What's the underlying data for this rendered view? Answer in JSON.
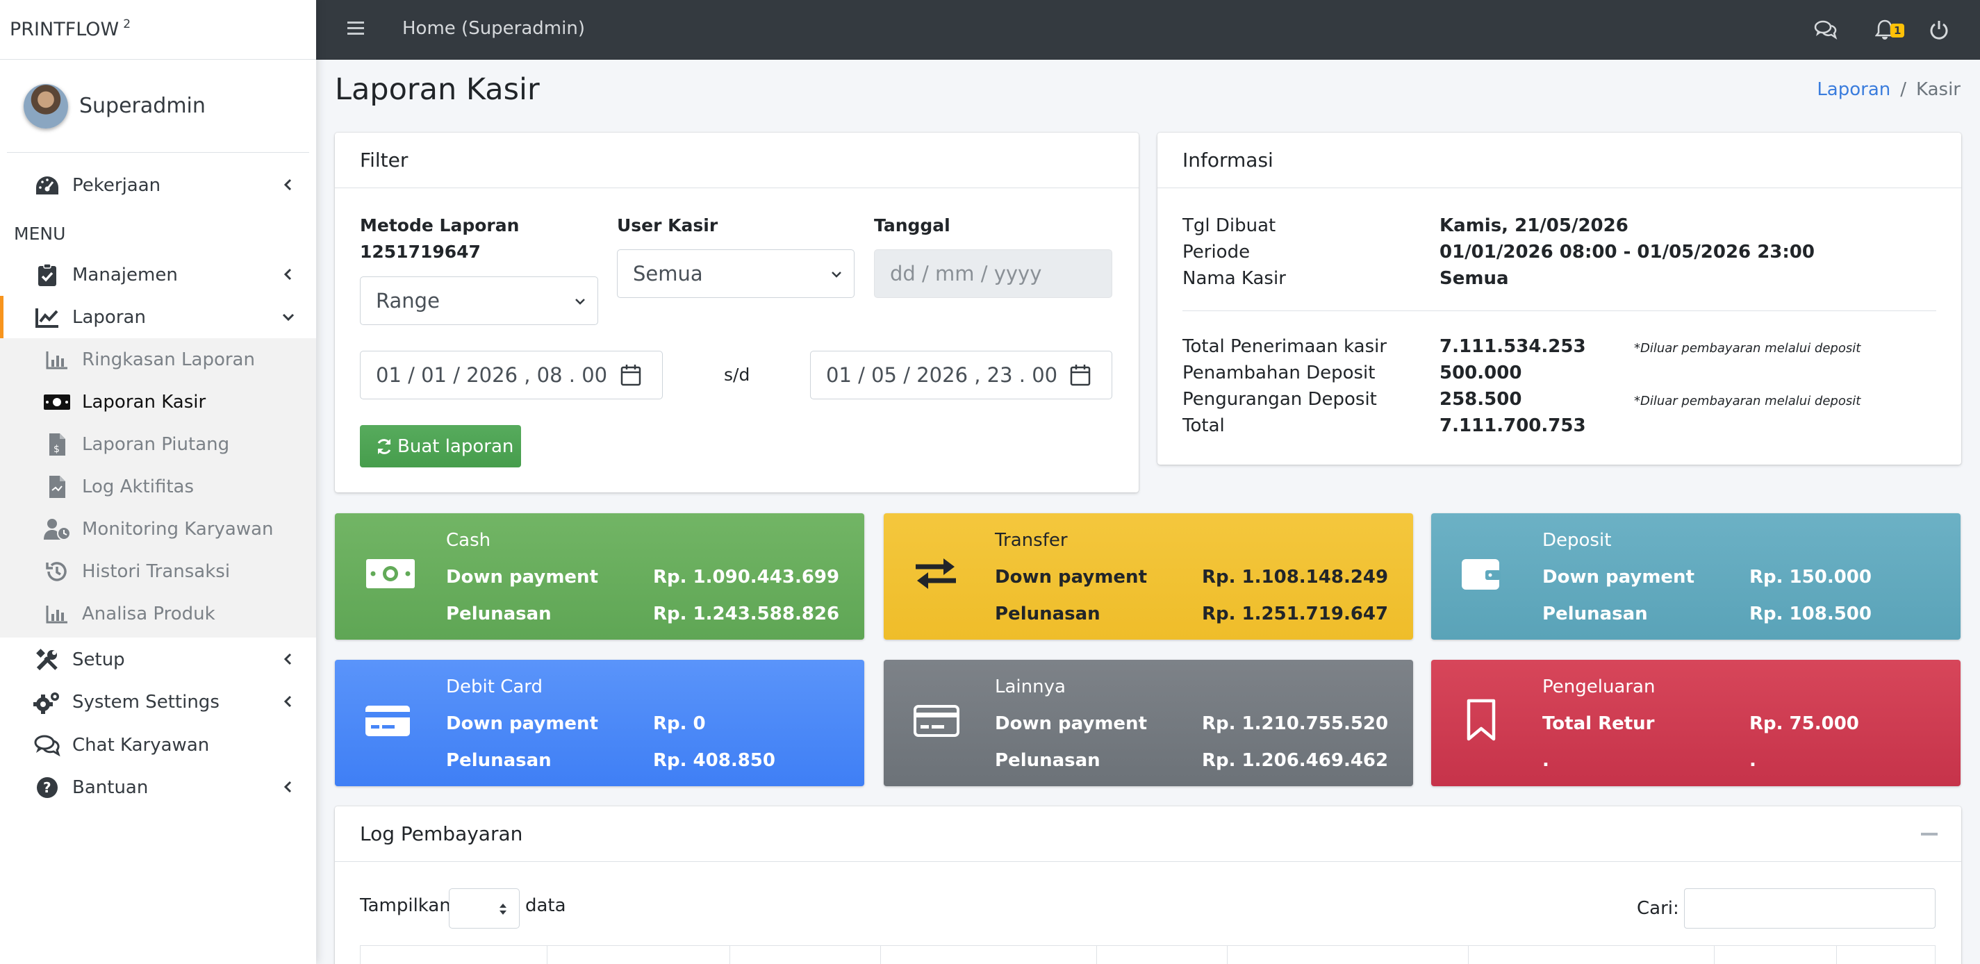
{
  "brand": {
    "name": "PRINTFLOW",
    "version": "2"
  },
  "user": {
    "name": "Superadmin"
  },
  "sidebar": {
    "menu_header": "MENU",
    "items": [
      {
        "label": "Pekerjaan",
        "icon": "tachometer-icon"
      },
      {
        "label": "Manajemen",
        "icon": "clipboard-check-icon"
      },
      {
        "label": "Laporan",
        "icon": "line-chart-icon"
      },
      {
        "label": "Setup",
        "icon": "tools-icon"
      },
      {
        "label": "System Settings",
        "icon": "cogs-icon"
      },
      {
        "label": "Chat Karyawan",
        "icon": "chat-icon"
      },
      {
        "label": "Bantuan",
        "icon": "question-circle-icon"
      }
    ],
    "sub_items": [
      {
        "label": "Ringkasan Laporan",
        "icon": "bar-chart-icon"
      },
      {
        "label": "Laporan Kasir",
        "icon": "money-bill-icon"
      },
      {
        "label": "Laporan Piutang",
        "icon": "invoice-dollar-icon"
      },
      {
        "label": "Log Aktifitas",
        "icon": "file-log-icon"
      },
      {
        "label": "Monitoring Karyawan",
        "icon": "user-clock-icon"
      },
      {
        "label": "Histori Transaksi",
        "icon": "history-icon"
      },
      {
        "label": "Analisa Produk",
        "icon": "bar-chart-icon"
      }
    ]
  },
  "topbar": {
    "title": "Home (Superadmin)",
    "notification_count": "1"
  },
  "page": {
    "title": "Laporan Kasir",
    "breadcrumb": {
      "parent": "Laporan",
      "separator": "/",
      "current": "Kasir"
    }
  },
  "filter": {
    "title": "Filter",
    "metode_label": "Metode Laporan",
    "metode_sub": "1251719647",
    "metode_value": "Range",
    "user_label": "User Kasir",
    "user_value": "Semua",
    "tanggal_label": "Tanggal",
    "tanggal_placeholder": "dd / mm / yyyy",
    "start_value": "01 / 01 / 2026 ,  08 . 00",
    "separator": "s/d",
    "end_value": "01 / 05 / 2026 ,  23 . 00",
    "button_label": "Buat laporan"
  },
  "info": {
    "title": "Informasi",
    "tgl_label": "Tgl Dibuat",
    "tgl_value": "Kamis, 21/05/2026",
    "periode_label": "Periode",
    "periode_value": "01/01/2026 08:00 - 01/05/2026 23:00",
    "kasir_label": "Nama Kasir",
    "kasir_value": "Semua",
    "penerimaan_label": "Total Penerimaan kasir",
    "penerimaan_value": "7.111.534.253",
    "penerimaan_note": "*Diluar pembayaran melalui deposit",
    "tambah_label": "Penambahan Deposit",
    "tambah_value": "500.000",
    "kurang_label": "Pengurangan Deposit",
    "kurang_value": "258.500",
    "kurang_note": "*Diluar pembayaran melalui deposit",
    "total_label": "Total",
    "total_value": "7.111.700.753"
  },
  "boxes": {
    "cash": {
      "title": "Cash",
      "r1_label": "Down payment",
      "r1_value": "Rp. 1.090.443.699",
      "r2_label": "Pelunasan",
      "r2_value": "Rp. 1.243.588.826",
      "color": "#62aa58"
    },
    "transfer": {
      "title": "Transfer",
      "r1_label": "Down payment",
      "r1_value": "Rp. 1.108.148.249",
      "r2_label": "Pelunasan",
      "r2_value": "Rp. 1.251.719.647",
      "color": "#f0c12f"
    },
    "deposit": {
      "title": "Deposit",
      "r1_label": "Down payment",
      "r1_value": "Rp. 150.000",
      "r2_label": "Pelunasan",
      "r2_value": "Rp. 108.500",
      "color": "#5fa8bd"
    },
    "debit": {
      "title": "Debit Card",
      "r1_label": "Down payment",
      "r1_value": "Rp. 0",
      "r2_label": "Pelunasan",
      "r2_value": "Rp. 408.850",
      "color": "#4786f7"
    },
    "lainnya": {
      "title": "Lainnya",
      "r1_label": "Down payment",
      "r1_value": "Rp. 1.210.755.520",
      "r2_label": "Pelunasan",
      "r2_value": "Rp. 1.206.469.462",
      "color": "#72777d"
    },
    "pengeluaran": {
      "title": "Pengeluaran",
      "r1_label": "Total Retur",
      "r1_value": "Rp. 75.000",
      "r2_label": ".",
      "r2_value": ".",
      "color": "#cc3a50"
    }
  },
  "log": {
    "title": "Log Pembayaran",
    "show_label": "Tampilkan",
    "data_label": "data",
    "search_label": "Cari:"
  }
}
